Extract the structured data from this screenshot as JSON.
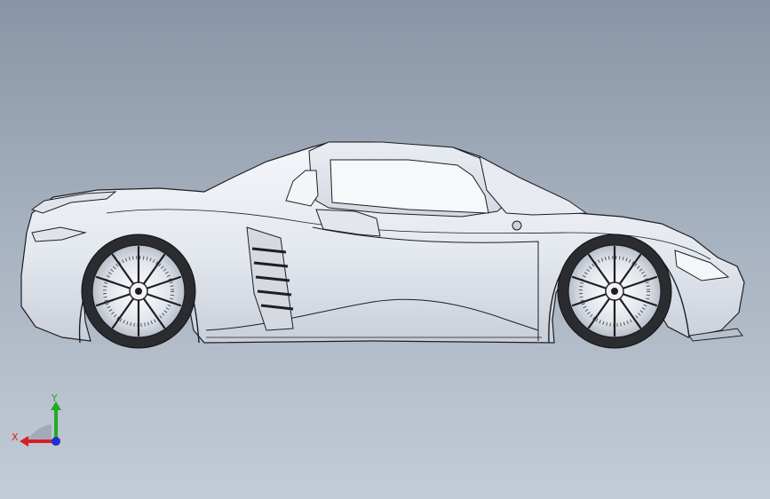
{
  "viewport": {
    "background_top": "#8895a6",
    "background_bottom": "#c3cbd6"
  },
  "model": {
    "body_fill": "#eef1f6",
    "body_shade": "#d8dde6",
    "line_color": "#1e1e22"
  },
  "triad": {
    "x_label": "X",
    "y_label": "Y",
    "x_color": "#d62020",
    "y_color": "#22aa22",
    "z_color": "#2030d0"
  }
}
